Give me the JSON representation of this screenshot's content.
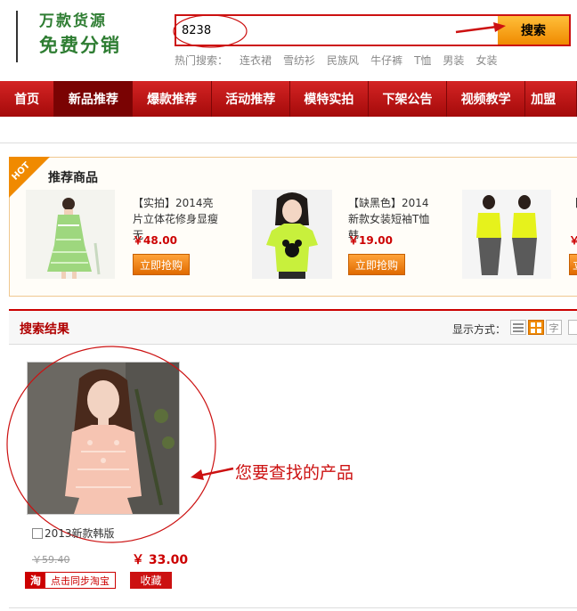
{
  "header": {
    "logo_line1": "万款货源",
    "logo_line2": "免费分销",
    "search_value": "8238",
    "search_button": "搜索",
    "hot_label": "热门搜索：",
    "hot_keywords": [
      "连衣裙",
      "雪纺衫",
      "民族风",
      "牛仔裤",
      "T恤",
      "男装",
      "女装"
    ]
  },
  "nav": {
    "items": [
      "首页",
      "新品推荐",
      "爆款推荐",
      "活动推荐",
      "模特实拍",
      "下架公告",
      "视频教学",
      "加盟"
    ]
  },
  "recommend": {
    "badge": "HOT",
    "title": "推荐商品",
    "items": [
      {
        "desc": "【实拍】2014亮片立体花修身显瘦无",
        "price": "￥48.00",
        "button": "立即抢购"
      },
      {
        "desc": "【缺黑色】2014新款女装短袖T恤 韩",
        "price": "￥19.00",
        "button": "立即抢购"
      },
      {
        "desc": "【",
        "price": "￥",
        "button": "立"
      }
    ]
  },
  "results": {
    "title": "搜索结果",
    "display_label": "显示方式：",
    "mode_text_icon": "字",
    "product": {
      "name": "2013新款韩版",
      "old_price": "￥59.40",
      "price": "￥ 33.00",
      "taobao_icon": "淘",
      "sync_label": "点击同步淘宝",
      "fav_label": "收藏"
    }
  },
  "annotation": "您要查找的产品",
  "colors": {
    "brand_red": "#cc1111",
    "nav_red": "#c01818",
    "orange": "#f08a00",
    "logo_green": "#2e7d32"
  }
}
